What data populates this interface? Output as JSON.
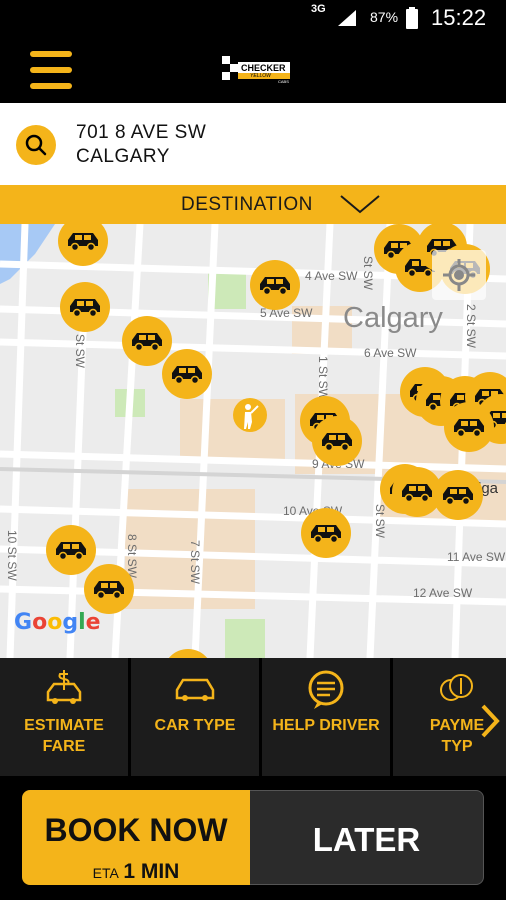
{
  "status_bar": {
    "network": "3G",
    "battery": "87%",
    "time": "15:22"
  },
  "app": {
    "logo_text": "CHECKER",
    "logo_sub": "YELLOW",
    "logo_tiny": "CABS"
  },
  "address": {
    "line1": "701 8 AVE SW",
    "line2": "CALGARY"
  },
  "destination": {
    "label": "DESTINATION"
  },
  "map": {
    "city_label": "Calgary",
    "street_labels": [
      "4 Ave SW",
      "5 Ave SW",
      "6 Ave SW",
      "9 Ave SW",
      "10 Ave SW",
      "11 Ave SW",
      "12 Ave SW",
      "9 St SW",
      "8 St SW",
      "7 St SW",
      "10 St SW",
      "1 St SW",
      "2 St SW",
      "St SW",
      "St SW",
      "lga"
    ],
    "attribution": {
      "g1": "G",
      "o1": "o",
      "o2": "o",
      "g2": "g",
      "l": "l",
      "e": "e"
    },
    "attribution_colors": [
      "#4285f4",
      "#ea4335",
      "#fbbc05",
      "#4285f4",
      "#34a853",
      "#ea4335"
    ]
  },
  "actions": [
    {
      "line1": "ESTIMATE",
      "line2": "FARE",
      "icon": "car-dollar-icon"
    },
    {
      "line1": "CAR TYPE",
      "line2": "",
      "icon": "car-outline-icon"
    },
    {
      "line1": "HELP DRIVER",
      "line2": "",
      "icon": "chat-bubble-icon"
    },
    {
      "line1": "PAYME",
      "line2": "TYP",
      "icon": "coins-icon"
    }
  ],
  "book": {
    "label": "BOOK NOW",
    "eta_label": "ETA",
    "eta_value": "1 MIN"
  },
  "later": {
    "label": "LATER"
  },
  "colors": {
    "accent": "#f4b41a",
    "dark": "#1c1c1c"
  }
}
